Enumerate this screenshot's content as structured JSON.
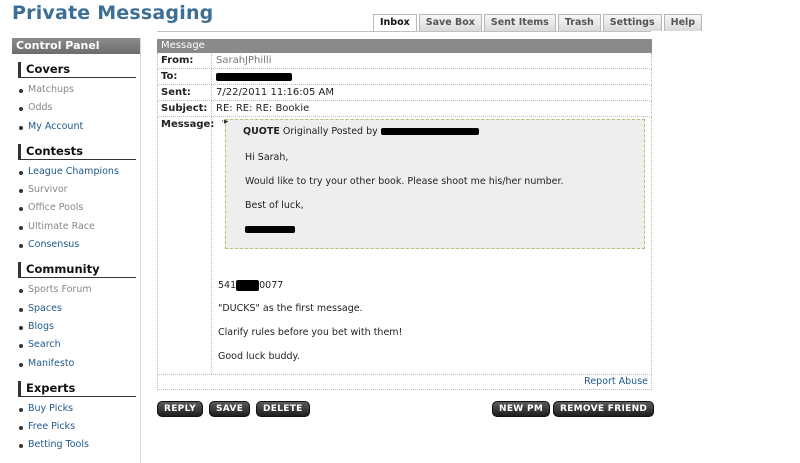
{
  "page_title": "Private Messaging",
  "tabs": [
    {
      "label": "Inbox",
      "active": true
    },
    {
      "label": "Save Box"
    },
    {
      "label": "Sent Items"
    },
    {
      "label": "Trash"
    },
    {
      "label": "Settings"
    },
    {
      "label": "Help"
    }
  ],
  "sidebar": {
    "header": "Control Panel",
    "sections": [
      {
        "title": "Covers",
        "items": [
          "Matchups",
          "Odds",
          "My Account"
        ]
      },
      {
        "title": "Contests",
        "items": [
          "League Champions",
          "Survivor",
          "Office Pools",
          "Ultimate Race",
          "Consensus"
        ]
      },
      {
        "title": "Community",
        "items": [
          "Sports Forum",
          "Spaces",
          "Blogs",
          "Search",
          "Manifesto"
        ]
      },
      {
        "title": "Experts",
        "items": [
          "Buy Picks",
          "Free Picks",
          "Betting Tools"
        ]
      }
    ]
  },
  "message": {
    "panel_title": "Message",
    "from_label": "From:",
    "from_value": "SarahJPhilli",
    "to_label": "To:",
    "sent_label": "Sent:",
    "sent_value": "7/22/2011 11:16:05 AM",
    "subject_label": "Subject:",
    "subject_value": "RE: RE: RE: Bookie",
    "message_label": "Message:",
    "quote_keyword": "QUOTE",
    "quote_prefix": "Originally Posted by",
    "quote_lines": [
      "Hi Sarah,",
      "Would like to try your other book.  Please shoot me his/her number.",
      "Best of luck,"
    ],
    "phone_prefix": "541",
    "phone_suffix": "0077",
    "body_lines": [
      "\"DUCKS\" as the first message.",
      "Clarify rules before you bet with them!",
      "Good luck buddy."
    ],
    "report_abuse": "Report Abuse"
  },
  "buttons": {
    "reply": "REPLY",
    "save": "SAVE",
    "delete": "DELETE",
    "new_pm": "NEW PM",
    "remove_friend": "REMOVE FRIEND"
  }
}
